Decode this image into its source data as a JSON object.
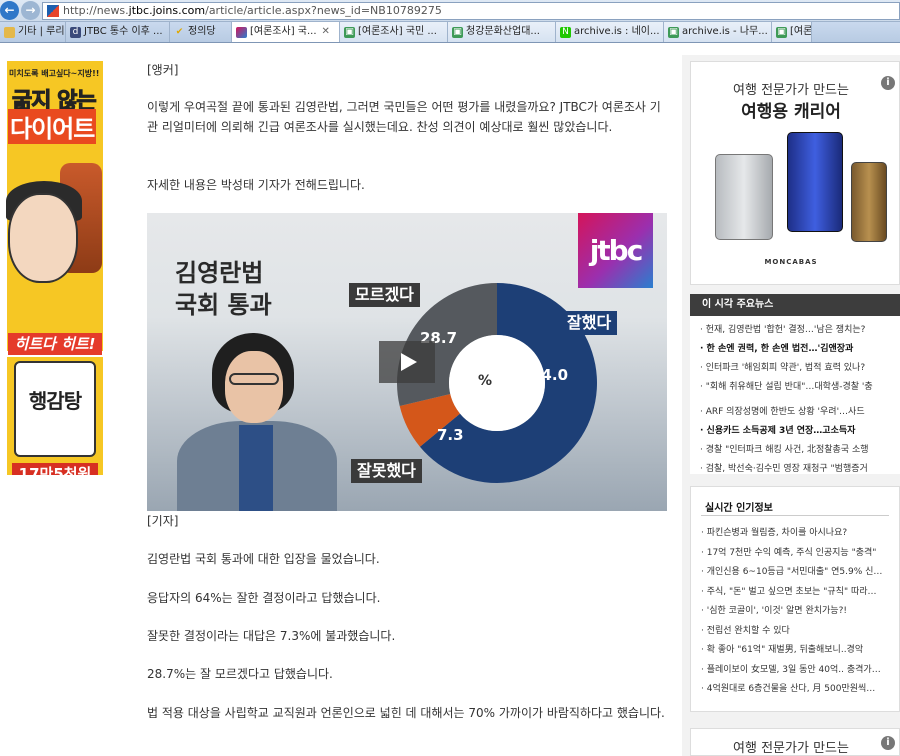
{
  "browser": {
    "url_prefix": "http://news.",
    "url_host": "jtbc.joins.com",
    "url_suffix": "/article/article.aspx?news_id=NB10789275",
    "bookmarks": [
      {
        "label": "기타 | 루리웹",
        "icon": "folder-icon"
      },
      {
        "label": "JTBC 통수 이후 ...",
        "icon": "dc-icon"
      },
      {
        "label": "정의당",
        "icon": "check-icon"
      }
    ],
    "tabs": [
      {
        "label": "[여론조사] 국...",
        "active": true
      },
      {
        "label": "[여론조사] 국민 ...",
        "active": false
      },
      {
        "label": "청강문화산업대...",
        "active": false
      },
      {
        "label": "archive.is : 네이...",
        "active": false
      },
      {
        "label": "archive.is - 나무...",
        "active": false
      },
      {
        "label": "[여론",
        "active": false
      }
    ]
  },
  "left_ad": {
    "small": "미치도록 배고싶다~지방!!",
    "line1": "굶지 않는",
    "line2": "다이어트",
    "hit": "히트다 히트!",
    "product": "행감탕",
    "price": "17만5천원"
  },
  "article": {
    "anchor_tag": "[앵커]",
    "lead": "이렇게 우여곡절 끝에 통과된 김영란법, 그러면 국민들은 어떤 평가를 내렸을까요? JTBC가 여론조사 기관 리얼미터에 의뢰해 긴급 여론조사를 실시했는데요. 찬성 의견이 예상대로 훨씬 많았습니다.",
    "intro": "자세한 내용은 박성태 기자가 전해드립니다.",
    "reporter_tag": "[기자]",
    "paragraphs": [
      "김영란법 국회 통과에 대한 입장을 물었습니다.",
      "응답자의 64%는 잘한 결정이라고 답했습니다.",
      "잘못한 결정이라는 대답은 7.3%에 불과했습니다.",
      "28.7%는 잘 모르겠다고 답했습니다.",
      "법 적용 대상을 사립학교 교직원과 언론인으로 넓힌 데 대해서는 70% 가까이가 바람직하다고 했습니다."
    ]
  },
  "figure": {
    "headline_1": "김영란법",
    "headline_2": "국회 통과",
    "logo": "jtbc",
    "center": "%",
    "callout_dont_know": "모르겠다",
    "callout_good": "잘했다",
    "callout_bad": "잘못했다"
  },
  "chart_data": {
    "type": "pie",
    "categories": [
      "잘했다",
      "잘못했다",
      "모르겠다"
    ],
    "values": [
      64.0,
      7.3,
      28.7
    ],
    "value_labels": [
      "64.0",
      "7.3",
      "28.7"
    ],
    "colors": [
      "#1d3f76",
      "#d4571a",
      "#55595e"
    ],
    "title": "",
    "legend": "callouts"
  },
  "right": {
    "ad_title_1": "여행 전문가가 만드는",
    "ad_title_2": "여행용 캐리어",
    "ad_brand": "MONCABAS",
    "info": "i",
    "news_head": "이 시각 주요뉴스",
    "news": [
      {
        "text": "· 헌재, 김영란법 '합헌' 결정…'남은 쟁치는?",
        "bold": false
      },
      {
        "text": "· 한 손엔 권력, 한 손엔 법전…'김앤장과",
        "bold": true
      },
      {
        "text": "· 인터파크 '해임회피 약관', 법적 효력 있나?",
        "bold": false
      },
      {
        "text": "· \"회해 취유해단 설립 반대\"…대학생-경찰 '충",
        "bold": false
      },
      {
        "text": "· ARF 의장성명에 한반도 상황 '우려'…사드",
        "bold": false
      },
      {
        "text": "· 신용카드 소득공제 3년 연장…고소득자",
        "bold": true
      },
      {
        "text": "· 경찰 \"인터파크 해킹 사건, 北정찰총국 소행",
        "bold": false
      },
      {
        "text": "· 검찰, 박선숙·김수민 영장 재청구 \"범행증거",
        "bold": false
      }
    ],
    "popular_head": "실시간 인기정보",
    "popular": [
      "· 파킨슨병과 월림증, 차이를 아시나요?",
      "· 17억 7천만 수익 예측, 주식 인공지능 \"충격\"",
      "· 개인신용 6~10등급 \"서민대출\" 연5.9% 신…",
      "· 주식, \"돈\" 벌고 싶으면 초보는 \"규칙\" 따라…",
      "· '심한 코골이', '이것' 알면 완치가능?!",
      "· 전립선 완치할 수 있다",
      "· 확 좋아 \"61억\" 재벌男, 뒤출해보니..경악",
      "· 플레이보이 女모델, 3일 동안 40억.. 충격가…",
      "· 4억원대로 6층건물을 산다, 月 500만원씩…"
    ],
    "ad2_title": "여행 전문가가 만드는"
  },
  "colors": {
    "good": "#1d3f76",
    "bad": "#d4571a",
    "unknown": "#55595e",
    "tab_bar": "#c9d9ee"
  }
}
